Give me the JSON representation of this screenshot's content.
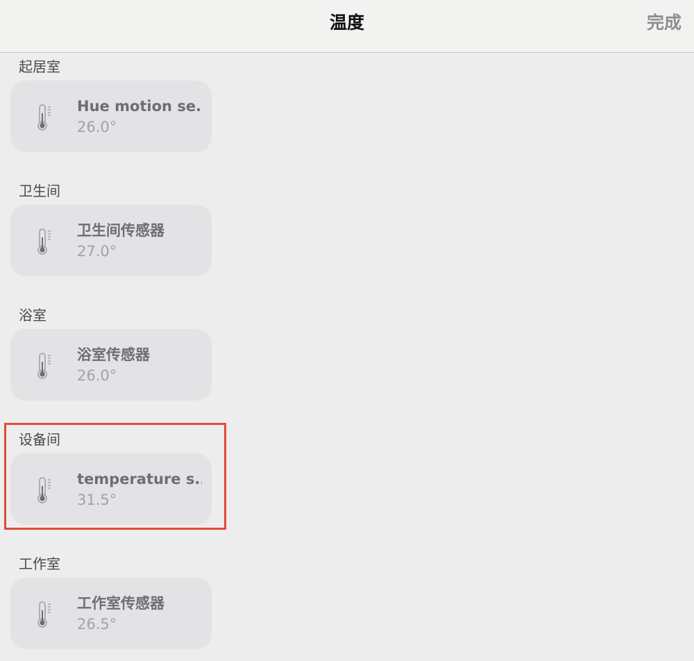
{
  "navbar": {
    "title": "温度",
    "done_label": "完成"
  },
  "sections": [
    {
      "title": "起居室",
      "sensor": {
        "name": "Hue motion se...",
        "value": "26.0°"
      }
    },
    {
      "title": "卫生间",
      "sensor": {
        "name": "卫生间传感器",
        "value": "27.0°"
      }
    },
    {
      "title": "浴室",
      "sensor": {
        "name": "浴室传感器",
        "value": "26.0°"
      }
    },
    {
      "title": "设备间",
      "sensor": {
        "name": "temperature s...",
        "value": "31.5°"
      }
    },
    {
      "title": "工作室",
      "sensor": {
        "name": "工作室传感器",
        "value": "26.5°"
      }
    }
  ],
  "icons": {
    "sensor_icon": "thermometer-icon"
  },
  "colors": {
    "highlight": "#e24a35"
  }
}
